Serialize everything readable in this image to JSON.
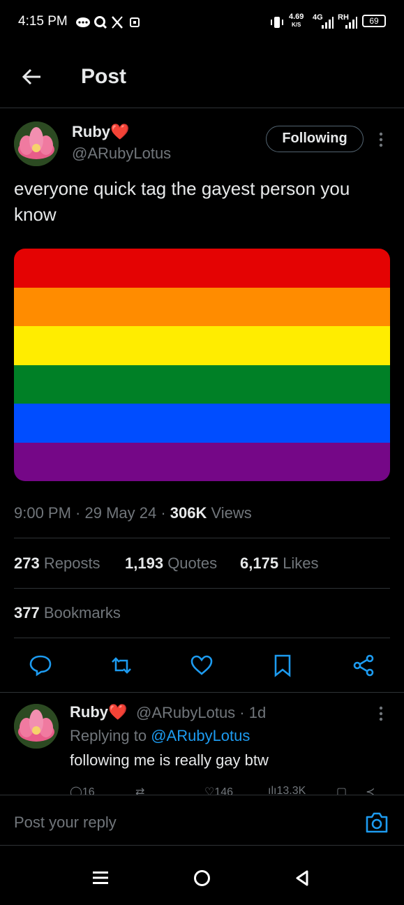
{
  "status_bar": {
    "time": "4:15 PM",
    "speed_value": "4.69",
    "speed_unit": "K/S",
    "network": "4G",
    "carrier_label": "RH",
    "battery": "69",
    "icons": [
      "chat-bubble-dots-icon",
      "search-q-icon",
      "x-logo-icon",
      "app-icon",
      "vibrate-icon",
      "signal-icon",
      "signal-icon"
    ]
  },
  "header": {
    "title": "Post",
    "back_icon": "arrow-left-icon"
  },
  "post": {
    "author_name": "Ruby",
    "author_emoji": "❤️",
    "author_handle": "@ARubyLotus",
    "follow_label": "Following",
    "text": "everyone quick tag the gayest person you know",
    "image": {
      "description": "rainbow flag",
      "stripes": [
        "#e40303",
        "#ff8c00",
        "#ffed00",
        "#008026",
        "#004dff",
        "#750787"
      ]
    },
    "time": "9:00 PM",
    "date": "29 May 24",
    "views_count": "306K",
    "views_label": "Views",
    "reposts_count": "273",
    "reposts_label": "Reposts",
    "quotes_count": "1,193",
    "quotes_label": "Quotes",
    "likes_count": "6,175",
    "likes_label": "Likes",
    "bookmarks_count": "377",
    "bookmarks_label": "Bookmarks"
  },
  "reply": {
    "author_name": "Ruby",
    "author_emoji": "❤️",
    "author_handle": "@ARubyLotus",
    "age": "1d",
    "replying_prefix": "Replying to",
    "replying_to": "@ARubyLotus",
    "text": "following me is really gay btw",
    "replies": "16",
    "likes": "146",
    "views": "13.3K"
  },
  "composer": {
    "placeholder": "Post your reply"
  },
  "colors": {
    "accent": "#1d9bf0",
    "muted": "#71767b",
    "text": "#e7e9ea",
    "divider": "#2f3336"
  }
}
